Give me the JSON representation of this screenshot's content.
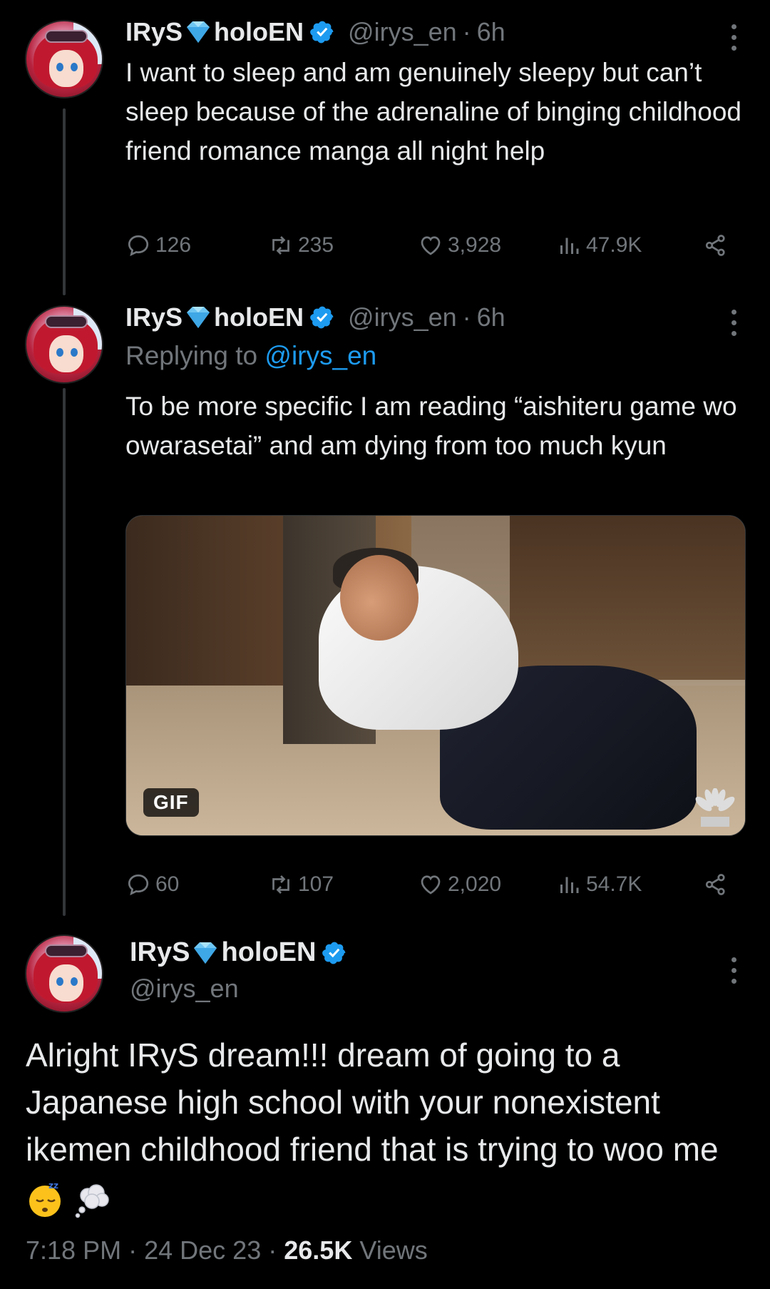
{
  "tweets": [
    {
      "name_part1": "IRyS",
      "name_part2": "holoEN",
      "handle": "@irys_en",
      "dot": "·",
      "time": "6h",
      "text": "I want to sleep and am genuinely sleepy but can’t sleep because of the adrenaline of binging childhood friend romance manga all night help",
      "stats": {
        "replies": "126",
        "reposts": "235",
        "likes": "3,928",
        "views": "47.9K"
      }
    },
    {
      "name_part1": "IRyS",
      "name_part2": "holoEN",
      "handle": "@irys_en",
      "dot": "·",
      "time": "6h",
      "replying_prefix": "Replying to ",
      "replying_to": "@irys_en",
      "text": "To be more specific I am reading “aishiteru game wo owarasetai” and am dying from too much kyun",
      "media_badge": "GIF",
      "stats": {
        "replies": "60",
        "reposts": "107",
        "likes": "2,020",
        "views": "54.7K"
      }
    }
  ],
  "focused": {
    "name_part1": "IRyS",
    "name_part2": "holoEN",
    "handle": "@irys_en",
    "text": "Alright IRyS dream!!! dream of going to a Japanese high school with your nonexistent ikemen childhood friend that is trying to woo me",
    "time": "7:18 PM",
    "dot": "·",
    "date": "24 Dec 23",
    "views_count": "26.5K",
    "views_label": "Views"
  },
  "icons": {
    "reply": "reply-icon",
    "repost": "repost-icon",
    "like": "heart-icon",
    "views": "views-icon",
    "share": "share-icon",
    "more": "more-icon",
    "verified": "verified-badge-icon",
    "gem": "gem-icon"
  },
  "colors": {
    "accent": "#1d9bf0",
    "muted": "#71767b",
    "text": "#e7e9ea",
    "background": "#000000"
  }
}
